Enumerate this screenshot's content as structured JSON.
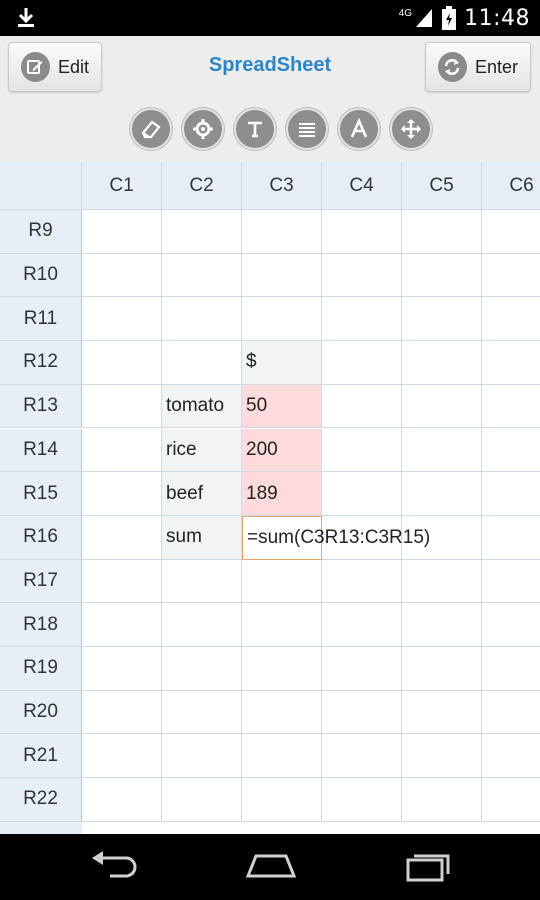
{
  "status": {
    "time": "11:48",
    "network": "4G",
    "icons": [
      "download-icon",
      "signal-icon",
      "battery-icon"
    ]
  },
  "app": {
    "title": "SpreadSheet"
  },
  "toolbar": {
    "edit_label": "Edit",
    "enter_label": "Enter"
  },
  "tools": [
    "eraser-icon",
    "gear-icon",
    "text-format-icon",
    "lines-icon",
    "font-icon",
    "move-icon"
  ],
  "columns": [
    "C1",
    "C2",
    "C3",
    "C4",
    "C5",
    "C6"
  ],
  "rows": [
    "R9",
    "R10",
    "R11",
    "R12",
    "R13",
    "R14",
    "R15",
    "R16",
    "R17",
    "R18",
    "R19",
    "R20",
    "R21",
    "R22"
  ],
  "cells": {
    "R12_C3": "$",
    "R13_C2": "tomato",
    "R13_C3": "50",
    "R14_C2": "rice",
    "R14_C3": "200",
    "R15_C2": "beef",
    "R15_C3": "189",
    "R16_C2": "sum",
    "R16_C3": "=sum(C3R13:C3R15)"
  },
  "colors": {
    "accent": "#2c84c9",
    "highlight": "#fddadb",
    "header": "#e6eef8"
  },
  "nav": [
    "back-icon",
    "home-icon",
    "recent-apps-icon"
  ]
}
